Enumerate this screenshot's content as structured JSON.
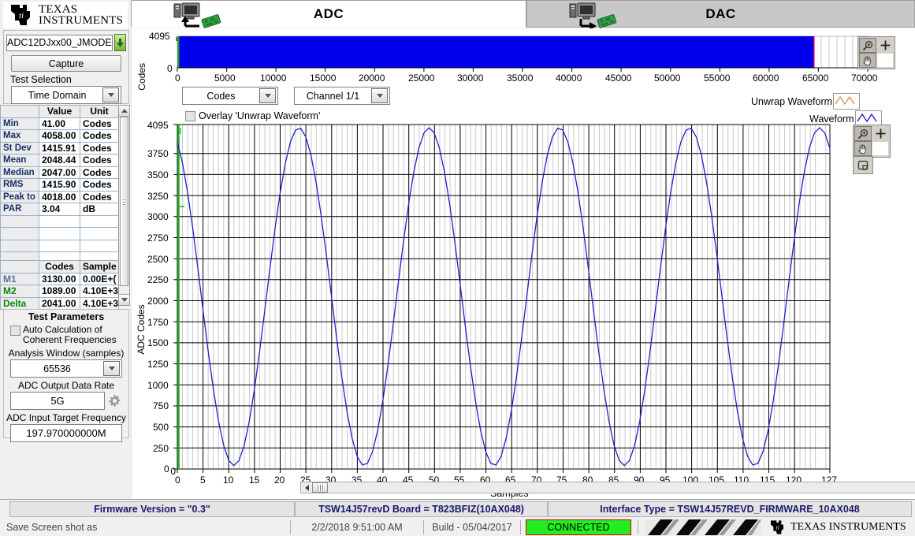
{
  "brand": {
    "name_line1": "TEXAS",
    "name_line2": "INSTRUMENTS"
  },
  "left": {
    "mode_value": "ADC12DJxx00_JMODE",
    "download_icon": "download-arrow-icon",
    "capture_label": "Capture",
    "test_selection_label": "Test Selection",
    "test_selection_value": "Time Domain"
  },
  "stats": {
    "headers": [
      "",
      "Value",
      "Unit"
    ],
    "rows": [
      {
        "label": "Min",
        "value": "41.00",
        "unit": "Codes"
      },
      {
        "label": "Max",
        "value": "4058.00",
        "unit": "Codes"
      },
      {
        "label": "St Dev",
        "value": "1415.91",
        "unit": "Codes"
      },
      {
        "label": "Mean",
        "value": "2048.44",
        "unit": "Codes"
      },
      {
        "label": "Median",
        "value": "2047.00",
        "unit": "Codes"
      },
      {
        "label": "RMS",
        "value": "1415.90",
        "unit": "Codes"
      },
      {
        "label": "Peak to P",
        "value": "4018.00",
        "unit": "Codes"
      },
      {
        "label": "PAR",
        "value": "3.04",
        "unit": "dB"
      }
    ]
  },
  "markers": {
    "headers": [
      "",
      "Codes",
      "Sample"
    ],
    "rows": [
      {
        "label": "M1",
        "codes": "3130.00",
        "sample": "0.00E+("
      },
      {
        "label": "M2",
        "codes": "1089.00",
        "sample": "4.10E+3"
      },
      {
        "label": "Delta",
        "codes": "2041.00",
        "sample": "4.10E+3"
      }
    ]
  },
  "test_parameters": {
    "title": "Test Parameters",
    "auto_calc_label_1": "Auto Calculation of",
    "auto_calc_label_2": "Coherent Frequencies",
    "auto_calc_checked": false,
    "analysis_window_label": "Analysis Window (samples)",
    "analysis_window_value": "65536",
    "output_rate_label": "ADC Output Data Rate",
    "output_rate_value": "5G",
    "gear_icon": "gear-icon",
    "input_freq_label": "ADC Input Target Frequency",
    "input_freq_value": "197.970000000M"
  },
  "tabs": [
    {
      "label": "ADC",
      "active": true,
      "icon": "computer-to-board-icon"
    },
    {
      "label": "DAC",
      "active": false,
      "icon": "board-to-computer-icon"
    }
  ],
  "top_chart": {
    "ylabel": "Codes",
    "y_ticks": [
      "4095",
      "0"
    ],
    "x_ticks": [
      "0",
      "5000",
      "10000",
      "15000",
      "20000",
      "25000",
      "30000",
      "35000",
      "40000",
      "45000",
      "50000",
      "55000",
      "60000",
      "65000",
      "70000"
    ],
    "fill_color": "#0000ee",
    "cursor_color": "#cc0055",
    "toolbar_icons": [
      "zoom-icon",
      "crosshair-icon",
      "pan-hand-icon"
    ]
  },
  "controls": {
    "units_value": "Codes",
    "channel_value": "Channel 1/1",
    "overlay_label": "Overlay 'Unwrap Waveform'",
    "overlay_checked": false
  },
  "legend": [
    {
      "label": "Unwrap Waveform",
      "color": "#d98a50"
    },
    {
      "label": "Waveform",
      "color": "#2020cc"
    }
  ],
  "main_toolbar_icons": [
    "zoom-icon",
    "crosshair-icon",
    "pan-hand-icon",
    "fit-screen-icon"
  ],
  "scroll": {
    "left_arrow": "scroll-left-icon",
    "right_arrow": "scroll-right-icon",
    "thumb": "scroll-thumb"
  },
  "status": {
    "firmware": "Firmware Version = \"0.3\"",
    "board": "TSW14J57revD Board = T823BFIZ(10AX048)",
    "interface": "Interface Type = TSW14J57REVD_FIRMWARE_10AX048",
    "save_label": "Save Screen shot as",
    "datetime": "2/2/2018 9:51:00 AM",
    "build": "Build  - 05/04/2017",
    "connected": "CONNECTED",
    "connected_color": "#22ee22"
  },
  "chart_data": {
    "type": "line",
    "title": "",
    "xlabel": "Samples",
    "ylabel": "ADC Codes",
    "xlim": [
      0,
      127
    ],
    "ylim": [
      0,
      4095
    ],
    "y_ticks": [
      0,
      250,
      500,
      750,
      1000,
      1250,
      1500,
      1750,
      2000,
      2250,
      2500,
      2750,
      3000,
      3250,
      3500,
      3750,
      4095
    ],
    "x_ticks": [
      0,
      5,
      10,
      15,
      20,
      25,
      30,
      35,
      40,
      45,
      50,
      55,
      60,
      65,
      70,
      75,
      80,
      85,
      90,
      95,
      100,
      105,
      110,
      115,
      120,
      127
    ],
    "grid": true,
    "legend_position": "top-right",
    "series": [
      {
        "name": "Waveform",
        "color": "#2020cc",
        "description": "Sine wave, mean 2048.44, amplitude approx 2009 codes, period approx 25.3 samples, min 41, max 4058",
        "mean": 2048.44,
        "amplitude": 2008.5,
        "period_samples": 25.33,
        "phase_deg": 113.5,
        "n_points": 128
      }
    ],
    "cursors": [
      {
        "name": "M1",
        "x": 0,
        "y": 3130,
        "color": "#00aa00"
      },
      {
        "name": "M2",
        "x": 0,
        "y": 1089,
        "color": "#00aa00"
      }
    ]
  }
}
